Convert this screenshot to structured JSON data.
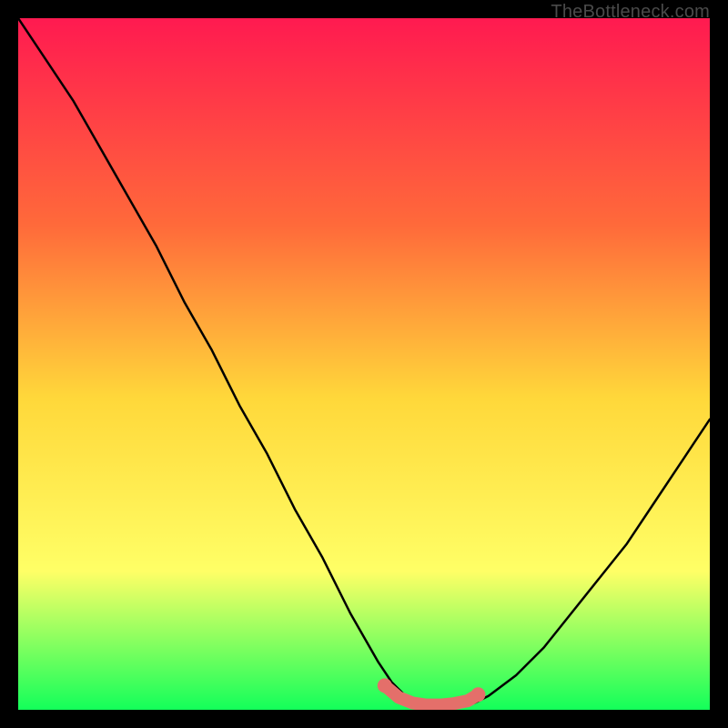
{
  "watermark": "TheBottleneck.com",
  "colors": {
    "gradient_top": "#ff1a50",
    "gradient_mid1": "#ff6a3a",
    "gradient_mid2": "#ffd83a",
    "gradient_mid3": "#ffff66",
    "gradient_bottom": "#13ff5a",
    "curve": "#000000",
    "highlight": "#e46f6a",
    "frame": "#000000"
  },
  "chart_data": {
    "type": "line",
    "title": "",
    "xlabel": "",
    "ylabel": "",
    "xlim": [
      0,
      100
    ],
    "ylim": [
      0,
      100
    ],
    "series": [
      {
        "name": "bottleneck-curve",
        "x": [
          0,
          4,
          8,
          12,
          16,
          20,
          24,
          28,
          32,
          36,
          40,
          44,
          48,
          52,
          54,
          56,
          58,
          60,
          62,
          64,
          66,
          68,
          72,
          76,
          80,
          84,
          88,
          92,
          96,
          100
        ],
        "y": [
          100,
          94,
          88,
          81,
          74,
          67,
          59,
          52,
          44,
          37,
          29,
          22,
          14,
          7,
          4,
          2,
          1,
          0.5,
          0.5,
          0.7,
          1,
          2,
          5,
          9,
          14,
          19,
          24,
          30,
          36,
          42
        ]
      }
    ],
    "highlight_segment": {
      "x": [
        53,
        55,
        57,
        59,
        61,
        63,
        65,
        66.5
      ],
      "y": [
        3.5,
        1.8,
        1.0,
        0.7,
        0.7,
        0.9,
        1.3,
        2.2
      ]
    }
  }
}
